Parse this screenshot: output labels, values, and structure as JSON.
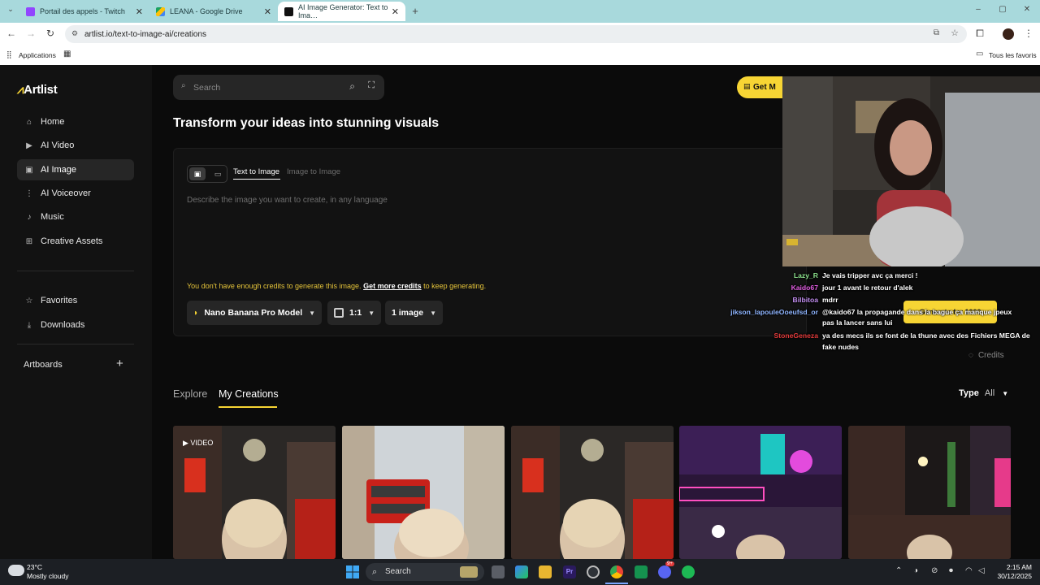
{
  "browser": {
    "tabs": [
      {
        "title": "Portail des appels - Twitch",
        "close": "✕"
      },
      {
        "title": "LEANA - Google Drive",
        "close": "✕"
      },
      {
        "title": "AI Image Generator: Text to Ima…",
        "close": "✕"
      }
    ],
    "new_tab": "+",
    "url": "artlist.io/text-to-image-ai/creations",
    "bookmarks": {
      "apps": "Applications",
      "all": "Tous les favoris"
    }
  },
  "app": {
    "logo": "Artlist",
    "nav": [
      {
        "label": "Home",
        "icon": "home-icon"
      },
      {
        "label": "AI Video",
        "icon": "video-icon"
      },
      {
        "label": "AI Image",
        "icon": "image-icon"
      },
      {
        "label": "AI Voiceover",
        "icon": "waveform-icon"
      },
      {
        "label": "Music",
        "icon": "music-note-icon"
      },
      {
        "label": "Creative Assets",
        "icon": "grid-icon"
      }
    ],
    "favorites": "Favorites",
    "downloads": "Downloads",
    "artboards": "Artboards",
    "add": "+",
    "search_placeholder": "Search",
    "get_more_button": "Get M",
    "headline": "Transform your ideas into stunning visuals",
    "mode_tabs": {
      "text": "Text to Image",
      "image": "Image to Image"
    },
    "prompt_placeholder": "Describe the image you want to create, in any language",
    "credits_warning": "You don't have enough credits to generate this image.",
    "credits_link": "Get more credits",
    "credits_suffix": "to keep generating.",
    "model": "Nano Banana Pro Model",
    "ratio": "1:1",
    "count": "1 image",
    "generate_button": "Generate for 1000",
    "credits_label": "Credits",
    "gallery_tabs": {
      "explore": "Explore",
      "mine": "My Creations"
    },
    "type_label": "Type",
    "type_value": "All",
    "video_badge": "VIDEO"
  },
  "chat": [
    {
      "user": "Lazy_R",
      "color": "#8ee48e",
      "msg": "Je vais tripper avc ça merci !"
    },
    {
      "user": "Kaido67",
      "color": "#e35ee3",
      "msg": "jour 1 avant le retour d'alek"
    },
    {
      "user": "Bilbitoa",
      "color": "#c28ef0",
      "msg": "mdrr"
    },
    {
      "user": "jikson_lapouleOoeufsd_or",
      "color": "#8fb5ff",
      "msg": "@kaido67 la propagande dans la bague ça manque jpeux"
    },
    {
      "user": "",
      "color": "#ffffff",
      "msg": "pas la lancer sans lui"
    },
    {
      "user": "StoneGeneza",
      "color": "#e23b3b",
      "msg": "ya des mecs ils se font de la thune avec des Fichiers MEGA de"
    },
    {
      "user": "",
      "color": "#ffffff",
      "msg": "fake nudes"
    }
  ],
  "taskbar": {
    "temp": "23°C",
    "weather": "Mostly cloudy",
    "search": "Search",
    "time": "2:15 AM",
    "date": "30/12/2025",
    "discord_badge": "9+"
  }
}
